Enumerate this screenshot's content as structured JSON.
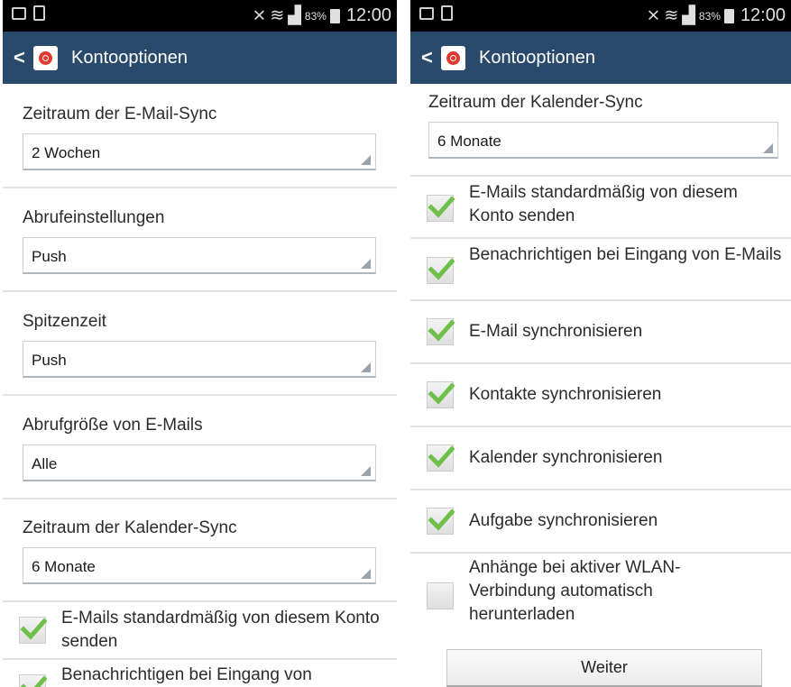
{
  "statusbar": {
    "battery": "83%",
    "time": "12:00"
  },
  "screen_title": "Kontooptionen",
  "left": {
    "spinners": [
      {
        "label": "Zeitraum der E-Mail-Sync",
        "value": "2 Wochen"
      },
      {
        "label": "Abrufeinstellungen",
        "value": "Push"
      },
      {
        "label": "Spitzenzeit",
        "value": "Push"
      },
      {
        "label": "Abrufgröße von E-Mails",
        "value": "Alle"
      },
      {
        "label": "Zeitraum der Kalender-Sync",
        "value": "6 Monate"
      }
    ],
    "checkboxes": [
      {
        "label": "E-Mails standardmäßig von diesem Konto senden",
        "checked": true
      },
      {
        "label": "Benachrichtigen bei Eingang von",
        "checked": true
      }
    ]
  },
  "right": {
    "spinner": {
      "label": "Zeitraum der Kalender-Sync",
      "value": "6 Monate"
    },
    "checkboxes": [
      {
        "label": "E-Mails standardmäßig von diesem Konto senden",
        "checked": true
      },
      {
        "label": "Benachrichtigen bei Eingang von E-Mails",
        "checked": true
      },
      {
        "label": "E-Mail synchronisieren",
        "checked": true
      },
      {
        "label": "Kontakte synchronisieren",
        "checked": true
      },
      {
        "label": "Kalender synchronisieren",
        "checked": true
      },
      {
        "label": "Aufgabe synchronisieren",
        "checked": true
      },
      {
        "label": "Anhänge bei aktiver WLAN-Verbindung automatisch herunterladen",
        "checked": false
      }
    ],
    "button": "Weiter"
  },
  "colors": {
    "actionbar": "#2a4a6b",
    "check": "#6fc04a",
    "logo": "#e3382f"
  },
  "icons": [
    "back-icon",
    "email-app-icon",
    "picture-icon",
    "document-icon",
    "mute-icon",
    "wifi-icon",
    "signal-icon",
    "battery-icon"
  ]
}
